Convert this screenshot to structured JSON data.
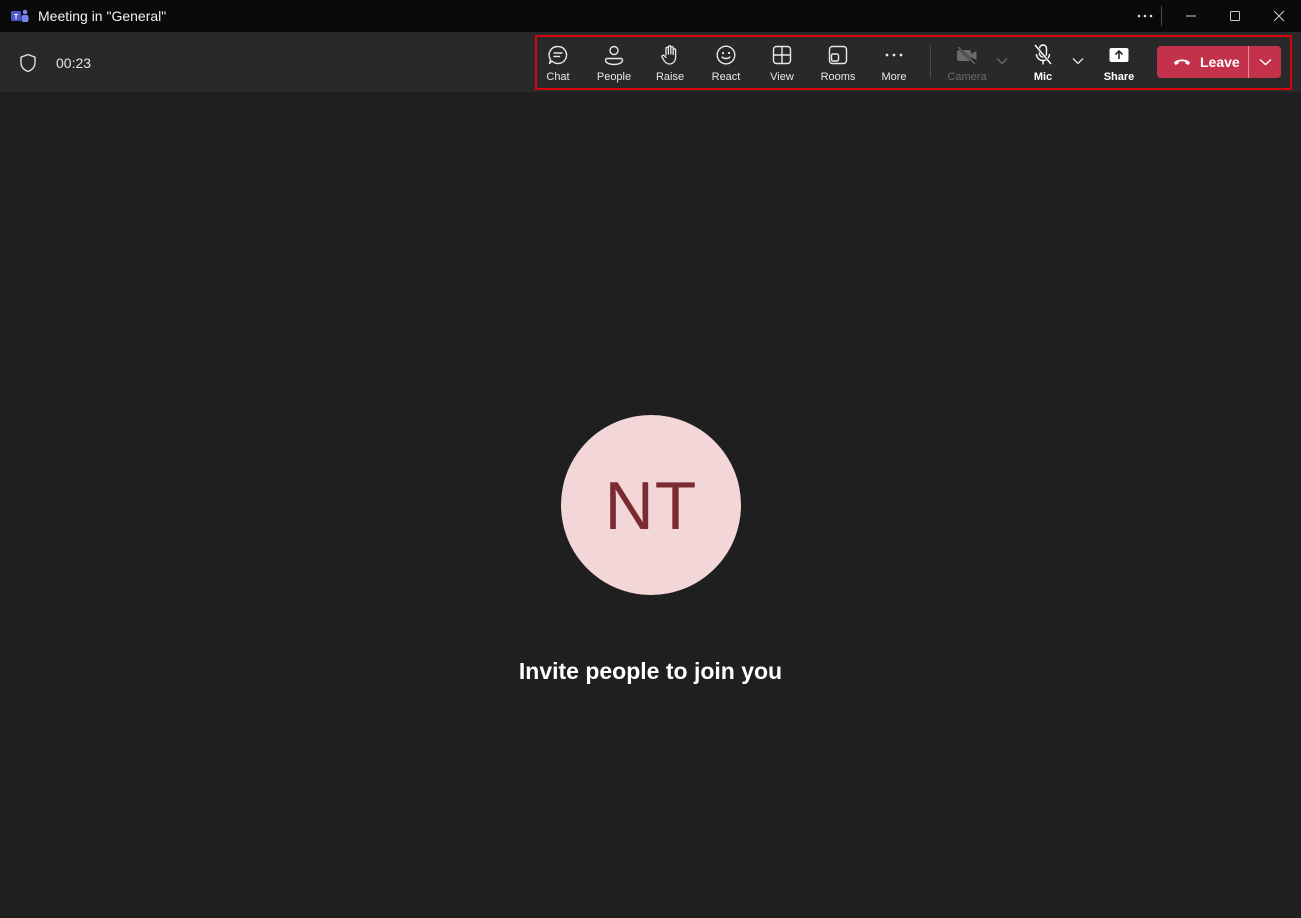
{
  "window": {
    "title": "Meeting in \"General\"",
    "app_icon": "teams-icon"
  },
  "meeting": {
    "timer": "00:23",
    "security_icon": "shield-icon"
  },
  "toolbar": {
    "chat": "Chat",
    "people": "People",
    "raise": "Raise",
    "react": "React",
    "view": "View",
    "rooms": "Rooms",
    "more": "More",
    "camera": "Camera",
    "mic": "Mic",
    "share": "Share",
    "leave": "Leave"
  },
  "stage": {
    "avatar_initials": "NT",
    "invite_text": "Invite people to join you"
  },
  "colors": {
    "leave_red": "#c4314b",
    "avatar_bg": "#f3d6d8",
    "avatar_text": "#7a2a31",
    "highlight": "#d6000e"
  }
}
